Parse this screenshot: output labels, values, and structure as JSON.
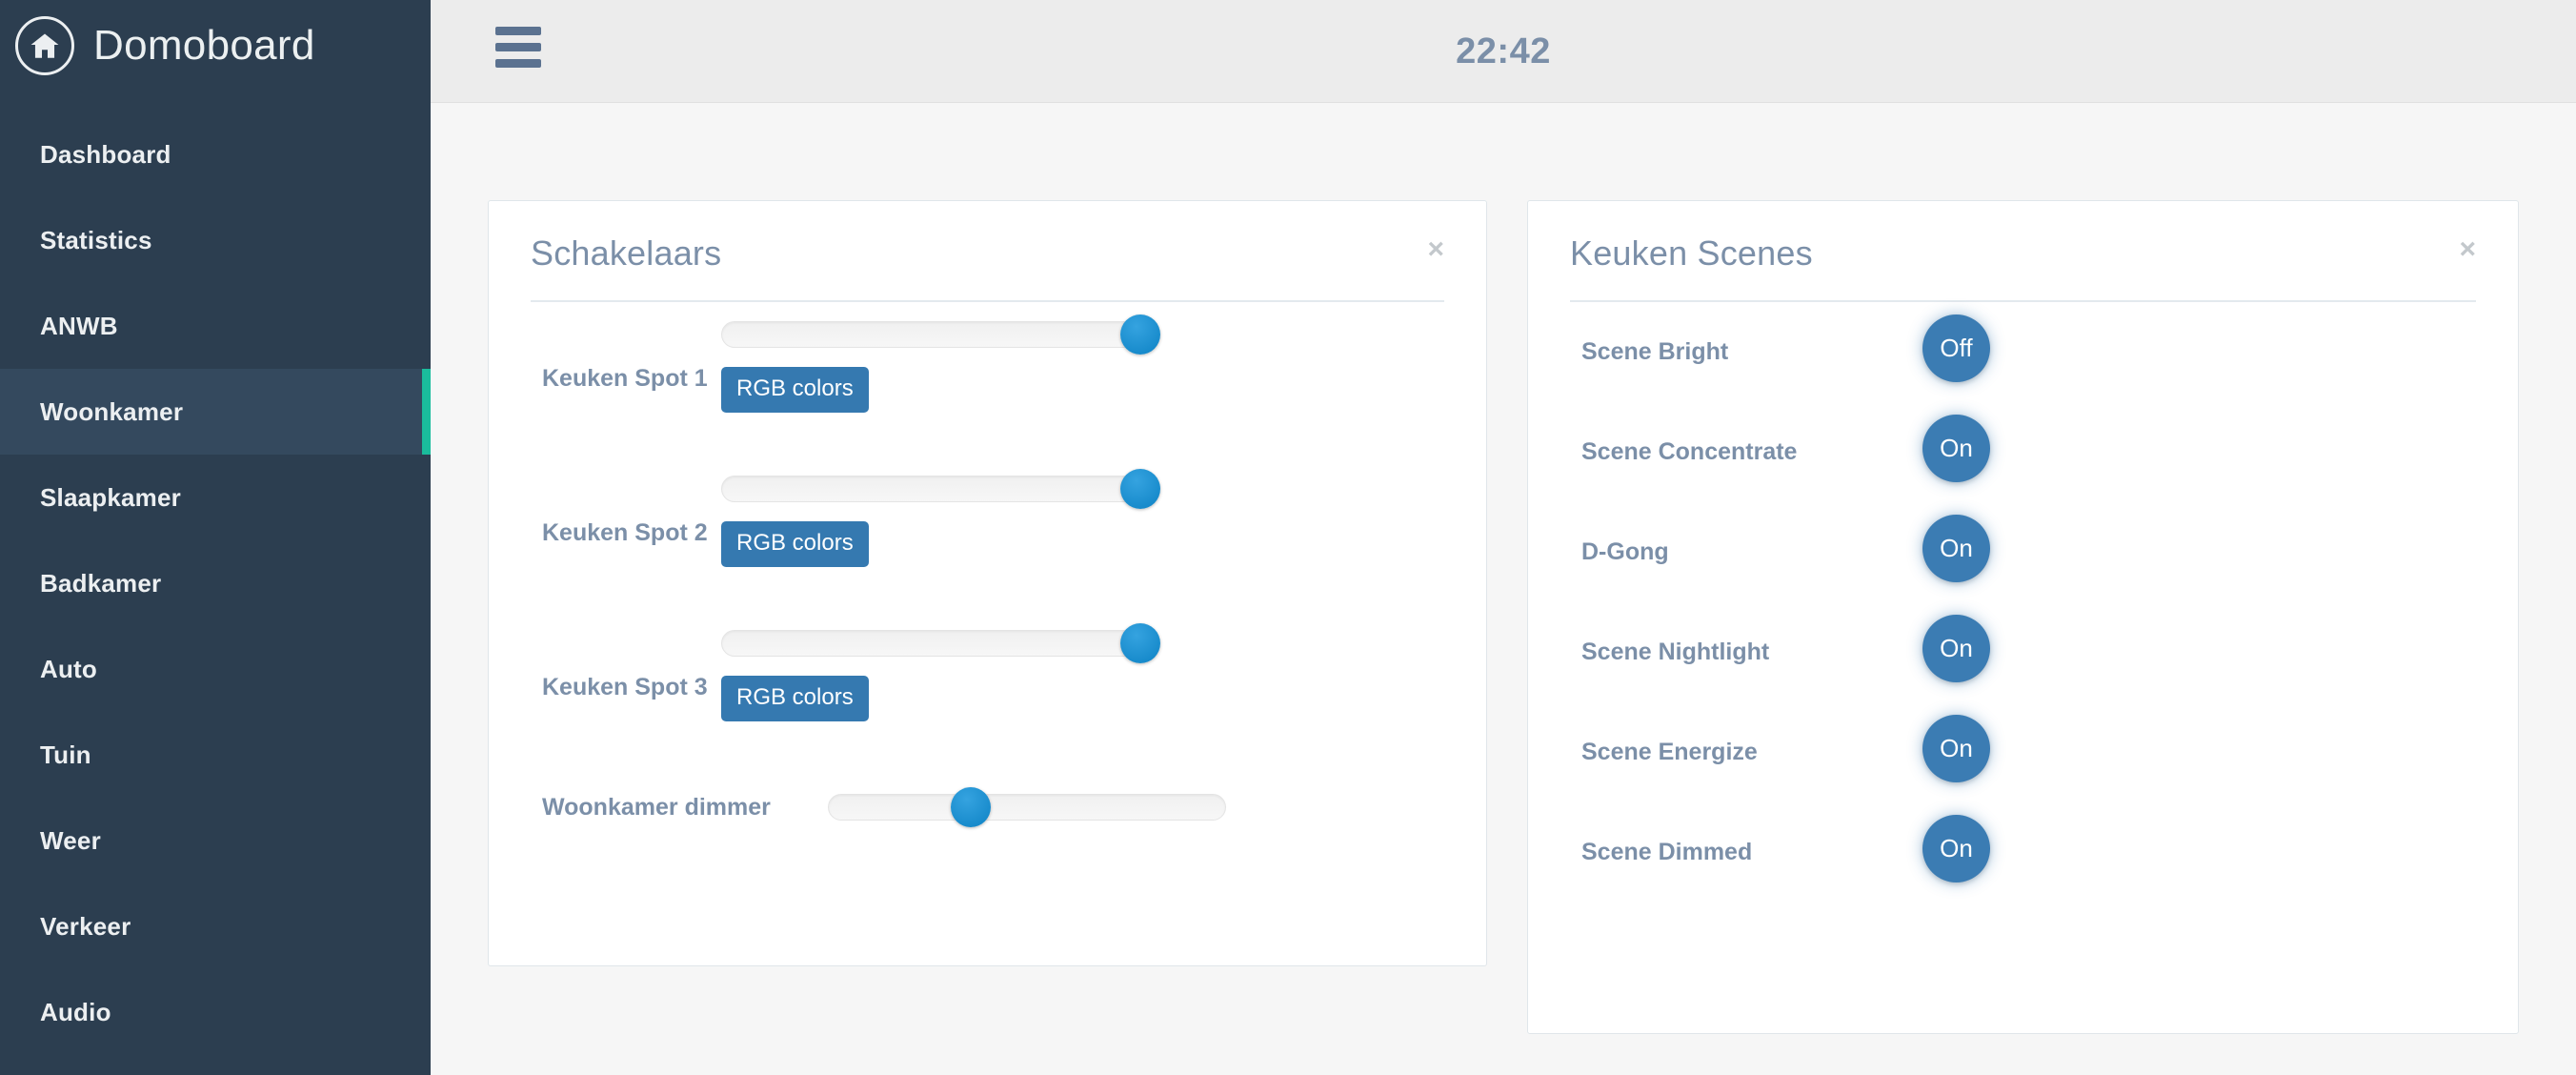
{
  "brand": {
    "name": "Domoboard",
    "logo_icon": "home-icon"
  },
  "sidebar": {
    "items": [
      {
        "label": "Dashboard",
        "active": false
      },
      {
        "label": "Statistics",
        "active": false
      },
      {
        "label": "ANWB",
        "active": false
      },
      {
        "label": "Woonkamer",
        "active": true
      },
      {
        "label": "Slaapkamer",
        "active": false
      },
      {
        "label": "Badkamer",
        "active": false
      },
      {
        "label": "Auto",
        "active": false
      },
      {
        "label": "Tuin",
        "active": false
      },
      {
        "label": "Weer",
        "active": false
      },
      {
        "label": "Verkeer",
        "active": false
      },
      {
        "label": "Audio",
        "active": false
      }
    ],
    "active_accent_color": "#1abc9c",
    "background_color": "#2c3e50"
  },
  "topbar": {
    "menu_icon": "hamburger-icon",
    "clock": "22:42",
    "background_color": "#ececec"
  },
  "panels": [
    {
      "id": "switches",
      "title": "Schakelaars",
      "close_label": "×",
      "rows": [
        {
          "label": "Keuken Spot 1",
          "slider_value": 100,
          "button_label": "RGB colors"
        },
        {
          "label": "Keuken Spot 2",
          "slider_value": 100,
          "button_label": "RGB colors"
        },
        {
          "label": "Keuken Spot 3",
          "slider_value": 100,
          "button_label": "RGB colors"
        }
      ],
      "dimmer": {
        "label": "Woonkamer dimmer",
        "slider_value": 36
      }
    },
    {
      "id": "scenes",
      "title": "Keuken Scenes",
      "close_label": "×",
      "scenes": [
        {
          "label": "Scene Bright",
          "state": "Off"
        },
        {
          "label": "Scene Concentrate",
          "state": "On"
        },
        {
          "label": "D-Gong",
          "state": "On"
        },
        {
          "label": "Scene Nightlight",
          "state": "On"
        },
        {
          "label": "Scene Energize",
          "state": "On"
        },
        {
          "label": "Scene Dimmed",
          "state": "On"
        }
      ]
    }
  ],
  "colors": {
    "accent_blue": "#3579b0",
    "slider_knob": "#0d82c4",
    "scene_button": "#3b7cb3",
    "label_text": "#7b8fa8"
  }
}
